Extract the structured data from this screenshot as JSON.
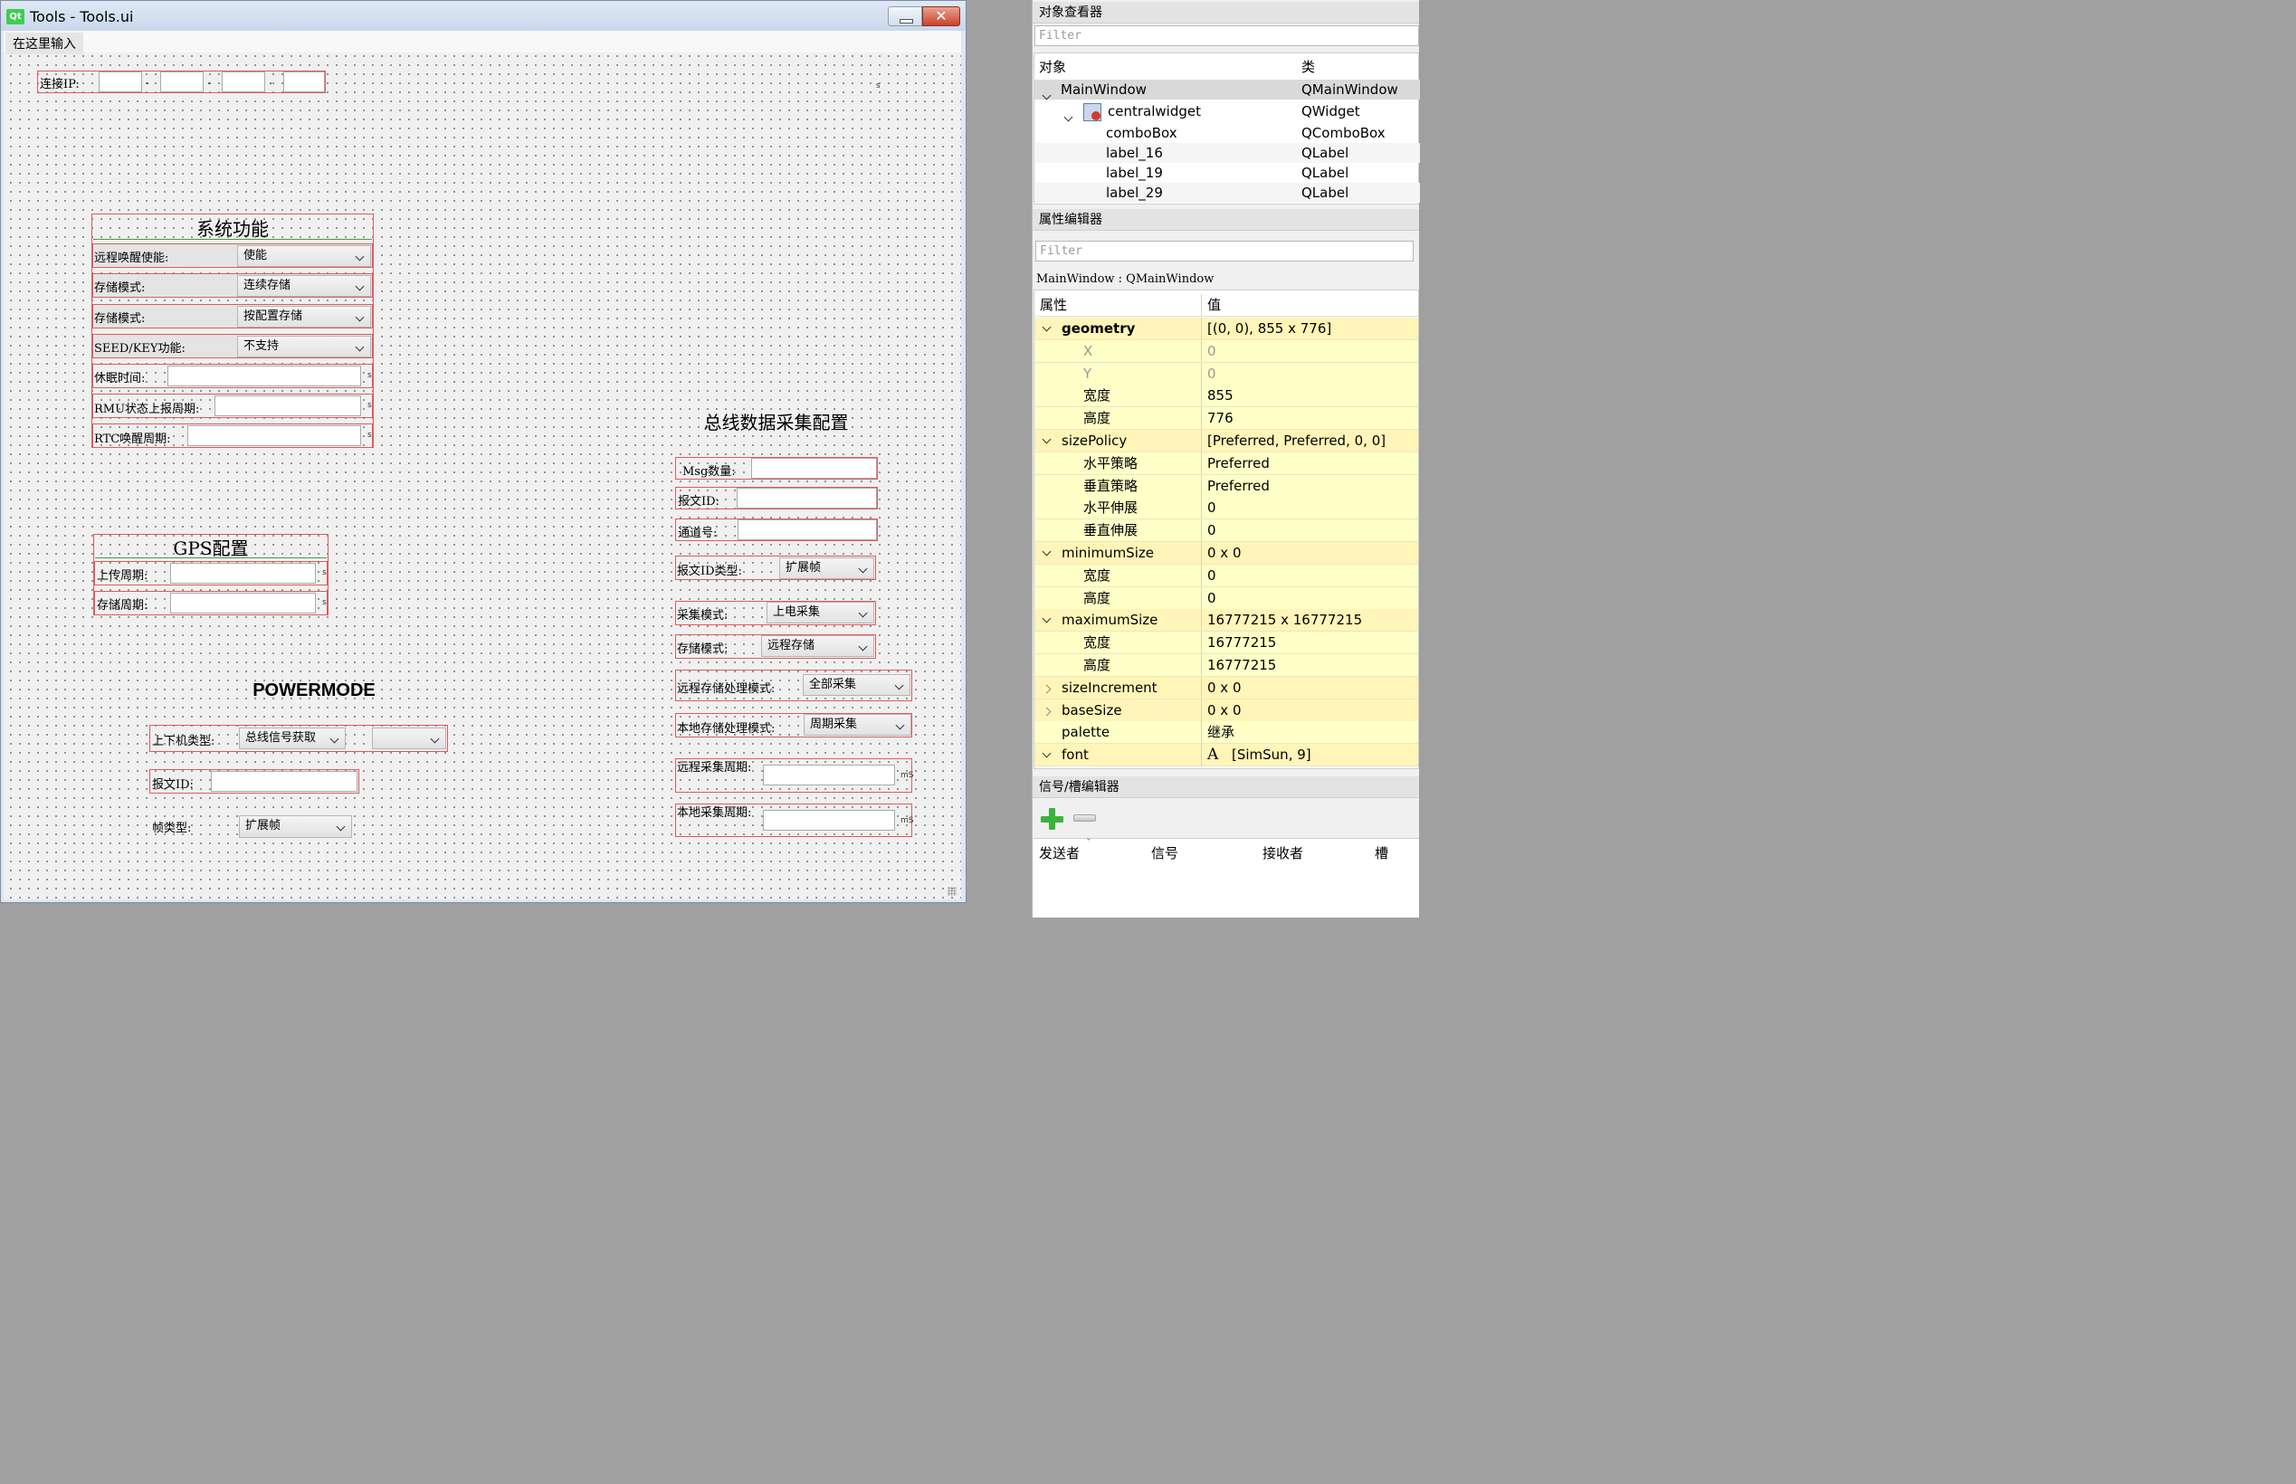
{
  "window": {
    "title": "Tools - Tools.ui",
    "app_logo": "Qt",
    "menu_placeholder": "在这里输入",
    "close_glyph": "✕"
  },
  "form": {
    "ip_label": "连接IP:",
    "ip_dots": [
      ".",
      ".",
      "."
    ],
    "ip_unit": "s",
    "system": {
      "title": "系统功能",
      "rows": [
        {
          "label": "远程唤醒使能:",
          "value": "使能"
        },
        {
          "label": "存储模式:",
          "value": "连续存储"
        },
        {
          "label": "存储模式:",
          "value": "按配置存储"
        },
        {
          "label": "SEED/KEY功能:",
          "value": "不支持"
        }
      ],
      "inputs": [
        {
          "label": "休眠时间:",
          "unit": "s"
        },
        {
          "label": "RMU状态上报周期:",
          "unit": "s"
        },
        {
          "label": "RTC唤醒周期:",
          "unit": "s"
        }
      ]
    },
    "gps": {
      "title": "GPS配置",
      "rows": [
        {
          "label": "上传周期:",
          "unit": "s"
        },
        {
          "label": "存储周期:",
          "unit": "s"
        }
      ]
    },
    "power": {
      "title": "POWERMODE",
      "host_label": "上下机类型:",
      "host_value": "总线信号获取",
      "host_value2": "",
      "msgid_label": "报文ID:",
      "frame_label": "帧类型:",
      "frame_value": "扩展帧"
    },
    "bus": {
      "title": "总线数据采集配置",
      "msg_count_label": "Msg数量:",
      "msgid_label": "报文ID:",
      "channel_label": "通道号:",
      "msgid_type_label": "报文ID类型:",
      "msgid_type_value": "扩展帧",
      "collect_mode_label": "采集模式:",
      "collect_mode_value": "上电采集",
      "store_mode_label": "存储模式:",
      "store_mode_value": "远程存储",
      "remote_proc_label": "远程存储处理模式:",
      "remote_proc_value": "全部采集",
      "local_proc_label": "本地存储处理模式:",
      "local_proc_value": "周期采集",
      "remote_period_label": "远程采集周期:",
      "local_period_label": "本地采集周期:",
      "ms_unit": "mS"
    }
  },
  "object_inspector": {
    "title": "对象查看器",
    "filter_placeholder": "Filter",
    "col_object": "对象",
    "col_class": "类",
    "rows": [
      {
        "name": "MainWindow",
        "cls": "QMainWindow"
      },
      {
        "name": "centralwidget",
        "cls": "QWidget"
      },
      {
        "name": "comboBox",
        "cls": "QComboBox"
      },
      {
        "name": "label_16",
        "cls": "QLabel"
      },
      {
        "name": "label_19",
        "cls": "QLabel"
      },
      {
        "name": "label_29",
        "cls": "QLabel"
      }
    ]
  },
  "property_editor": {
    "title": "属性编辑器",
    "filter_placeholder": "Filter",
    "context": "MainWindow : QMainWindow",
    "col_prop": "属性",
    "col_value": "值",
    "rows": [
      {
        "k": "geometry",
        "v": "[(0, 0), 855 x 776]",
        "bold": true,
        "expand": "open"
      },
      {
        "k": "X",
        "v": "0",
        "sub": true,
        "grey": true
      },
      {
        "k": "Y",
        "v": "0",
        "sub": true,
        "grey": true
      },
      {
        "k": "宽度",
        "v": "855",
        "sub": true
      },
      {
        "k": "高度",
        "v": "776",
        "sub": true
      },
      {
        "k": "sizePolicy",
        "v": "[Preferred, Preferred, 0, 0]",
        "expand": "open"
      },
      {
        "k": "水平策略",
        "v": "Preferred",
        "sub": true
      },
      {
        "k": "垂直策略",
        "v": "Preferred",
        "sub": true
      },
      {
        "k": "水平伸展",
        "v": "0",
        "sub": true
      },
      {
        "k": "垂直伸展",
        "v": "0",
        "sub": true
      },
      {
        "k": "minimumSize",
        "v": "0 x 0",
        "expand": "open"
      },
      {
        "k": "宽度",
        "v": "0",
        "sub": true
      },
      {
        "k": "高度",
        "v": "0",
        "sub": true
      },
      {
        "k": "maximumSize",
        "v": "16777215 x 16777215",
        "expand": "open"
      },
      {
        "k": "宽度",
        "v": "16777215",
        "sub": true
      },
      {
        "k": "高度",
        "v": "16777215",
        "sub": true
      },
      {
        "k": "sizeIncrement",
        "v": "0 x 0",
        "expand": "closed"
      },
      {
        "k": "baseSize",
        "v": "0 x 0",
        "expand": "closed"
      },
      {
        "k": "palette",
        "v": "继承"
      },
      {
        "k": "font",
        "v": "[SimSun, 9]",
        "expand": "open",
        "fonticon": "A"
      }
    ]
  },
  "signal_editor": {
    "title": "信号/槽编辑器",
    "cols": [
      "发送者",
      "信号",
      "接收者",
      "槽"
    ]
  }
}
